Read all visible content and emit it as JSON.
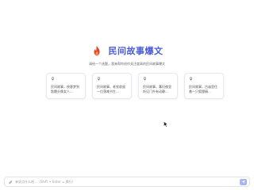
{
  "brand": {
    "title": "民间故事爆文",
    "logo_icon": "fire-icon",
    "accent_color": "#4b5bd6",
    "logo_color": "#e0472f"
  },
  "subtitle": "请给一个选题，我来帮你创作关注度高的民间故事爆文",
  "cards": [
    {
      "icon": "lightbulb-icon",
      "text": "民间故事，侠客梦到骷髅头像女人…"
    },
    {
      "icon": "lightbulb-icon",
      "text": "民间故事，老农收留一位落难书生…"
    },
    {
      "icon": "lightbulb-icon",
      "text": "民间故事，寡妇夜里听见门外有动静…"
    },
    {
      "icon": "lightbulb-icon",
      "text": "民间故事，古庙里住着一只狐狸精…"
    }
  ],
  "input": {
    "placeholder": "来说点什么吧…（Shift + Enter = 换行）",
    "value": "",
    "attach_icon": "paperclip-icon",
    "send_icon": "send-icon",
    "send_color": "#a9b4f2"
  },
  "cursor_icon": "mouse-pointer-icon"
}
